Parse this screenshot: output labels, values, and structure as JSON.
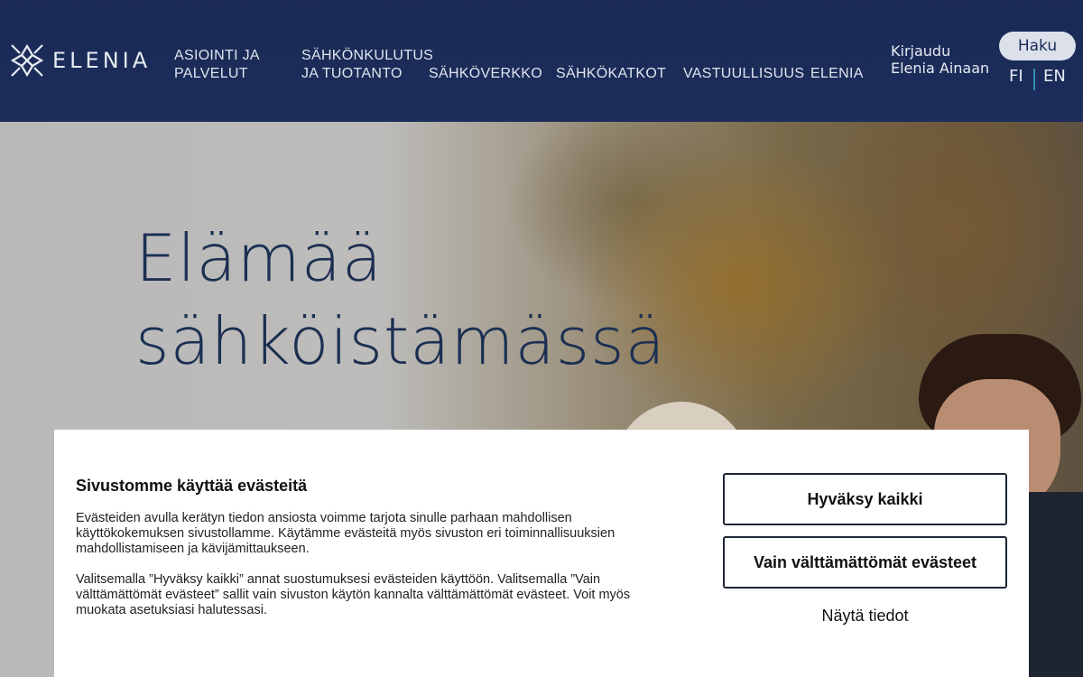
{
  "header": {
    "logo_text": "ELENIA",
    "nav": [
      {
        "label": "ASIOINTI JA PALVELUT"
      },
      {
        "label": "SÄHKÖNKULUTUS JA TUOTANTO"
      },
      {
        "label": "SÄHKÖVERKKO"
      },
      {
        "label": "SÄHKÖKATKOT"
      },
      {
        "label": "VASTUULLISUUS"
      },
      {
        "label": "ELENIA"
      }
    ],
    "login_line1": "Kirjaudu",
    "login_line2": "Elenia Ainaan",
    "search_label": "Haku",
    "lang_fi": "FI",
    "lang_en": "EN",
    "colors": {
      "header_bg": "#1d2d5c",
      "lang_separator": "#2f8fb0"
    }
  },
  "hero": {
    "title_line1": "Elämää",
    "title_line2": "sähköistämässä"
  },
  "cookie_banner": {
    "title": "Sivustomme käyttää evästeitä",
    "paragraph1": "Evästeiden avulla kerätyn tiedon ansiosta voimme tarjota sinulle parhaan mahdollisen käyttökokemuksen sivustollamme. Käytämme evästeitä myös sivuston eri toiminnallisuuksien mahdollistamiseen ja kävijämittaukseen.",
    "paragraph2": "Valitsemalla ”Hyväksy kaikki” annat suostumuksesi evästeiden käyttöön. Valitsemalla ”Vain välttämättömät evästeet” sallit vain sivuston käytön kannalta välttämättömät evästeet. Voit myös muokata asetuksiasi halutessasi.",
    "accept_all": "Hyväksy kaikki",
    "necessary_only": "Vain välttämättömät evästeet",
    "show_details": "Näytä tiedot"
  }
}
